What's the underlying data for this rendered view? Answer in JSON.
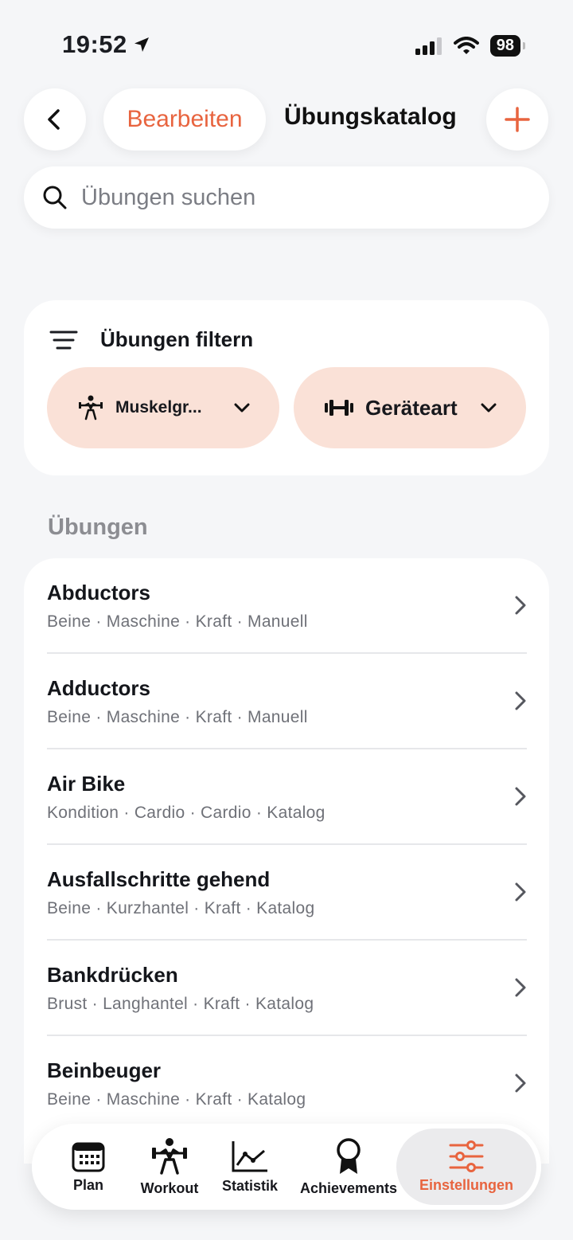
{
  "status_bar": {
    "time": "19:52",
    "battery": "98"
  },
  "header": {
    "title": "Übungskatalog",
    "edit_label": "Bearbeiten"
  },
  "search": {
    "placeholder": "Übungen suchen"
  },
  "filter": {
    "title": "Übungen filtern",
    "chips": [
      {
        "label": "Muskelgr..."
      },
      {
        "label": "Geräteart"
      }
    ]
  },
  "section_title": "Übungen",
  "exercises": [
    {
      "name": "Abductors",
      "meta": "Beine · Maschine · Kraft · Manuell"
    },
    {
      "name": "Adductors",
      "meta": "Beine · Maschine · Kraft · Manuell"
    },
    {
      "name": "Air Bike",
      "meta": "Kondition · Cardio · Cardio · Katalog"
    },
    {
      "name": "Ausfallschritte gehend",
      "meta": "Beine · Kurzhantel · Kraft · Katalog"
    },
    {
      "name": "Bankdrücken",
      "meta": "Brust · Langhantel · Kraft · Katalog"
    },
    {
      "name": "Beinbeuger",
      "meta": "Beine · Maschine · Kraft · Katalog"
    }
  ],
  "tabs": [
    {
      "label": "Plan",
      "icon": "calendar-icon"
    },
    {
      "label": "Workout",
      "icon": "weightlifter-icon"
    },
    {
      "label": "Statistik",
      "icon": "chart-icon"
    },
    {
      "label": "Achievements",
      "icon": "award-icon"
    },
    {
      "label": "Einstellungen",
      "icon": "sliders-icon",
      "active": true
    }
  ],
  "colors": {
    "accent": "#e8643f",
    "chip_bg": "#fae1d7",
    "background": "#f5f6f8"
  }
}
